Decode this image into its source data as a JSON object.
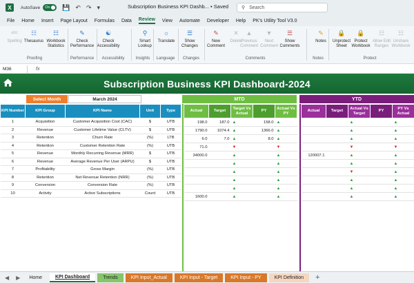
{
  "titlebar": {
    "autosave_label": "AutoSave",
    "toggle_label": "On",
    "title": "Subscription Business KPI Dashb... • Saved",
    "search_placeholder": "Search"
  },
  "menu": [
    "File",
    "Home",
    "Insert",
    "Page Layout",
    "Formulas",
    "Data",
    "Review",
    "View",
    "Automate",
    "Developer",
    "Help",
    "PK's Utility Tool V3.0"
  ],
  "menu_active": "Review",
  "ribbon": {
    "buttons": [
      {
        "label": "Spelling",
        "icon": "spelling-icon",
        "disabled": true
      },
      {
        "label": "Thesaurus",
        "icon": "thesaurus-icon",
        "disabled": false
      },
      {
        "label": "Workbook Statistics",
        "icon": "statistics-icon",
        "disabled": false
      },
      {
        "label": "Check Performance",
        "icon": "performance-icon",
        "disabled": false
      },
      {
        "label": "Check Accessibility",
        "icon": "accessibility-icon",
        "disabled": false
      },
      {
        "label": "Smart Lookup",
        "icon": "smart-lookup-icon",
        "disabled": false
      },
      {
        "label": "Translate",
        "icon": "translate-icon",
        "disabled": false
      },
      {
        "label": "Show Changes",
        "icon": "show-changes-icon",
        "disabled": false
      },
      {
        "label": "New Comment",
        "icon": "new-comment-icon",
        "disabled": false
      },
      {
        "label": "Delete",
        "icon": "delete-comment-icon",
        "disabled": true
      },
      {
        "label": "Previous Comment",
        "icon": "previous-comment-icon",
        "disabled": true
      },
      {
        "label": "Next Comment",
        "icon": "next-comment-icon",
        "disabled": true
      },
      {
        "label": "Show Comments",
        "icon": "show-comments-icon",
        "disabled": false
      },
      {
        "label": "Notes",
        "icon": "notes-icon",
        "disabled": false
      },
      {
        "label": "Unprotect Sheet",
        "icon": "unprotect-icon",
        "disabled": false
      },
      {
        "label": "Protect Workbook",
        "icon": "protect-workbook-icon",
        "disabled": false
      },
      {
        "label": "Allow Edit Ranges",
        "icon": "allow-edit-icon",
        "disabled": true
      },
      {
        "label": "Unshare Workbook",
        "icon": "unshare-icon",
        "disabled": true
      }
    ],
    "groups": [
      "Proofing",
      "Performance",
      "Accessibility",
      "Insights",
      "Language",
      "Changes",
      "Comments",
      "Notes",
      "Protect"
    ]
  },
  "formula_bar": {
    "name_box": "M36",
    "fx": "fx"
  },
  "dashboard": {
    "title": "Subscription Business KPI Dashboard-2024",
    "select_month_label": "Select Month",
    "select_month_value": "March 2024",
    "mtd_label": "MTD",
    "ytd_label": "YTD",
    "left_headers": [
      "KPI Number",
      "KPI Group",
      "KPI Name",
      "Unit",
      "Type"
    ],
    "mtd_headers": [
      "Actual",
      "Target",
      "Target Vs Actual",
      "PY",
      "Actual Vs PY"
    ],
    "ytd_headers": [
      "Actual",
      "Target",
      "Actual Vs Target",
      "PY",
      "PY Vs Actual"
    ],
    "rows": [
      {
        "num": "1",
        "group": "Acquisition",
        "name": "Customer Acquisition Cost (CAC)",
        "unit": "$",
        "type": "UTB",
        "mtd": {
          "actual": "198.0",
          "target": "187.0",
          "tva": "up",
          "py": "158.0",
          "avp": "up"
        },
        "ytd": {
          "actual": "",
          "target": "",
          "avt": "up",
          "py": "",
          "pva": "up"
        }
      },
      {
        "num": "2",
        "group": "Revenue",
        "name": "Customer Lifetime Value (CLTV)",
        "unit": "$",
        "type": "UTB",
        "mtd": {
          "actual": "1790.0",
          "target": "1074.4",
          "tva": "up",
          "py": "1366.0",
          "avp": "up"
        },
        "ytd": {
          "actual": "",
          "target": "",
          "avt": "up",
          "py": "",
          "pva": "up"
        }
      },
      {
        "num": "3",
        "group": "Retention",
        "name": "Churn Rate",
        "unit": "(%)",
        "type": "LTB",
        "mtd": {
          "actual": "6.0",
          "target": "7.0",
          "tva": "up",
          "py": "8.0",
          "avp": "up"
        },
        "ytd": {
          "actual": "",
          "target": "",
          "avt": "up",
          "py": "",
          "pva": "up"
        }
      },
      {
        "num": "4",
        "group": "Retention",
        "name": "Customer Retention Rate",
        "unit": "(%)",
        "type": "UTB",
        "mtd": {
          "actual": "71.0",
          "target": "",
          "tva": "down",
          "py": "",
          "avp": "down"
        },
        "ytd": {
          "actual": "",
          "target": "",
          "avt": "down",
          "py": "",
          "pva": "down"
        }
      },
      {
        "num": "5",
        "group": "Revenue",
        "name": "Monthly Recurring Revenue (MRR)",
        "unit": "$",
        "type": "UTB",
        "mtd": {
          "actual": "34000.0",
          "target": "",
          "tva": "up",
          "py": "",
          "avp": "up"
        },
        "ytd": {
          "actual": "120007.1",
          "target": "",
          "avt": "up",
          "py": "",
          "pva": "up"
        }
      },
      {
        "num": "6",
        "group": "Revenue",
        "name": "Average Revenue Per User (ARPU)",
        "unit": "$",
        "type": "UTB",
        "mtd": {
          "actual": "",
          "target": "",
          "tva": "up",
          "py": "",
          "avp": "up"
        },
        "ytd": {
          "actual": "",
          "target": "",
          "avt": "up",
          "py": "",
          "pva": "up"
        }
      },
      {
        "num": "7",
        "group": "Profitability",
        "name": "Gross Margin",
        "unit": "(%)",
        "type": "UTB",
        "mtd": {
          "actual": "",
          "target": "",
          "tva": "up",
          "py": "",
          "avp": "up"
        },
        "ytd": {
          "actual": "",
          "target": "",
          "avt": "down",
          "py": "",
          "pva": "up"
        }
      },
      {
        "num": "8",
        "group": "Retention",
        "name": "Net Revenue Retention (NRR)",
        "unit": "(%)",
        "type": "UTB",
        "mtd": {
          "actual": "",
          "target": "",
          "tva": "up",
          "py": "",
          "avp": "up"
        },
        "ytd": {
          "actual": "",
          "target": "",
          "avt": "up",
          "py": "",
          "pva": "up"
        }
      },
      {
        "num": "9",
        "group": "Conversion",
        "name": "Conversion Rate",
        "unit": "(%)",
        "type": "UTB",
        "mtd": {
          "actual": "",
          "target": "",
          "tva": "up",
          "py": "",
          "avp": "up"
        },
        "ytd": {
          "actual": "",
          "target": "",
          "avt": "up",
          "py": "",
          "pva": "up"
        }
      },
      {
        "num": "10",
        "group": "Activity",
        "name": "Active Subscriptions",
        "unit": "Count",
        "type": "UTB",
        "mtd": {
          "actual": "1600.0",
          "target": "",
          "tva": "up",
          "py": "",
          "avp": "up"
        },
        "ytd": {
          "actual": "",
          "target": "",
          "avt": "up",
          "py": "",
          "pva": "up"
        }
      }
    ]
  },
  "sheet_tabs": [
    {
      "label": "Home",
      "style": "home"
    },
    {
      "label": "KPI Dashboard",
      "style": "active"
    },
    {
      "label": "Trends",
      "style": "trends"
    },
    {
      "label": "KPI Input_Actual",
      "style": "orange"
    },
    {
      "label": "KPI Input - Target",
      "style": "orange"
    },
    {
      "label": "KPI Input - PY",
      "style": "orange"
    },
    {
      "label": "KPI Definition",
      "style": "def"
    }
  ],
  "add_tab_symbol": "+"
}
